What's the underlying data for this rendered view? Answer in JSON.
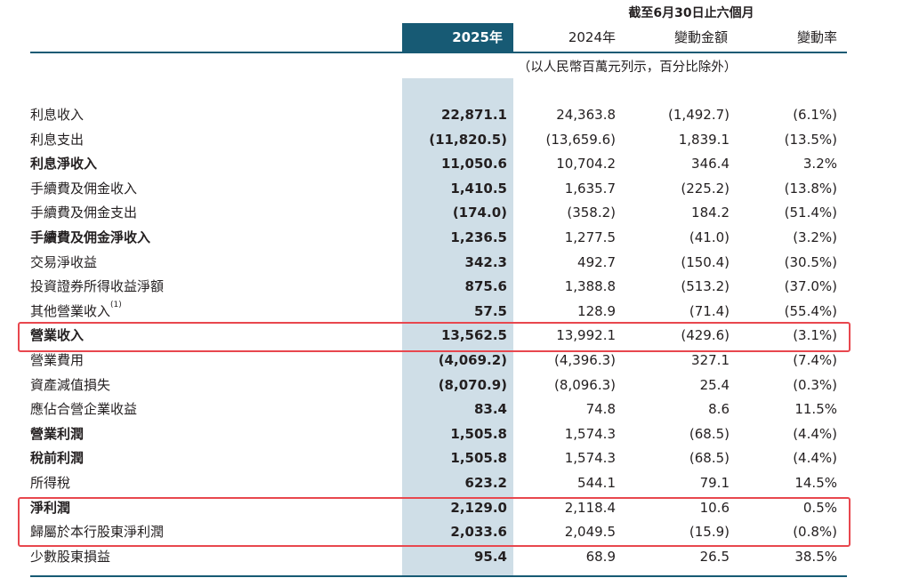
{
  "header": {
    "period": "截至6月30日止六個月",
    "col_2025": "2025年",
    "col_2024": "2024年",
    "col_change": "變動金額",
    "col_rate": "變動率",
    "unit_note": "（以人民幣百萬元列示，百分比除外）"
  },
  "rows": [
    {
      "label": "利息收入",
      "bold": false,
      "v2025": "22,871.1",
      "v2024": "24,363.8",
      "change": "(1,492.7)",
      "rate": "(6.1%)"
    },
    {
      "label": "利息支出",
      "bold": false,
      "v2025": "(11,820.5)",
      "v2024": "(13,659.6)",
      "change": "1,839.1",
      "rate": "(13.5%)"
    },
    {
      "label": "利息淨收入",
      "bold": true,
      "v2025": "11,050.6",
      "v2024": "10,704.2",
      "change": "346.4",
      "rate": "3.2%"
    },
    {
      "label": "手續費及佣金收入",
      "bold": false,
      "v2025": "1,410.5",
      "v2024": "1,635.7",
      "change": "(225.2)",
      "rate": "(13.8%)"
    },
    {
      "label": "手續費及佣金支出",
      "bold": false,
      "v2025": "(174.0)",
      "v2024": "(358.2)",
      "change": "184.2",
      "rate": "(51.4%)"
    },
    {
      "label": "手續費及佣金淨收入",
      "bold": true,
      "v2025": "1,236.5",
      "v2024": "1,277.5",
      "change": "(41.0)",
      "rate": "(3.2%)"
    },
    {
      "label": "交易淨收益",
      "bold": false,
      "v2025": "342.3",
      "v2024": "492.7",
      "change": "(150.4)",
      "rate": "(30.5%)"
    },
    {
      "label": "投資證券所得收益淨額",
      "bold": false,
      "v2025": "875.6",
      "v2024": "1,388.8",
      "change": "(513.2)",
      "rate": "(37.0%)"
    },
    {
      "label": "其他營業收入",
      "sup": "(1)",
      "bold": false,
      "v2025": "57.5",
      "v2024": "128.9",
      "change": "(71.4)",
      "rate": "(55.4%)"
    },
    {
      "label": "營業收入",
      "bold": true,
      "v2025": "13,562.5",
      "v2024": "13,992.1",
      "change": "(429.6)",
      "rate": "(3.1%)"
    },
    {
      "label": "營業費用",
      "bold": false,
      "v2025": "(4,069.2)",
      "v2024": "(4,396.3)",
      "change": "327.1",
      "rate": "(7.4%)"
    },
    {
      "label": "資產減值損失",
      "bold": false,
      "v2025": "(8,070.9)",
      "v2024": "(8,096.3)",
      "change": "25.4",
      "rate": "(0.3%)"
    },
    {
      "label": "應佔合營企業收益",
      "bold": false,
      "v2025": "83.4",
      "v2024": "74.8",
      "change": "8.6",
      "rate": "11.5%"
    },
    {
      "label": "營業利潤",
      "bold": true,
      "v2025": "1,505.8",
      "v2024": "1,574.3",
      "change": "(68.5)",
      "rate": "(4.4%)"
    },
    {
      "label": "稅前利潤",
      "bold": true,
      "v2025": "1,505.8",
      "v2024": "1,574.3",
      "change": "(68.5)",
      "rate": "(4.4%)"
    },
    {
      "label": "所得稅",
      "bold": false,
      "v2025": "623.2",
      "v2024": "544.1",
      "change": "79.1",
      "rate": "14.5%"
    },
    {
      "label": "淨利潤",
      "bold": true,
      "v2025": "2,129.0",
      "v2024": "2,118.4",
      "change": "10.6",
      "rate": "0.5%"
    },
    {
      "label": "歸屬於本行股東淨利潤",
      "bold": false,
      "v2025": "2,033.6",
      "v2024": "2,049.5",
      "change": "(15.9)",
      "rate": "(0.8%)"
    },
    {
      "label": "少數股東損益",
      "bold": false,
      "v2025": "95.4",
      "v2024": "68.9",
      "change": "26.5",
      "rate": "38.5%"
    }
  ],
  "colors": {
    "header_bg": "#175a74",
    "highlight_col": "#cfdee7",
    "annotation_box": "#e8474e"
  }
}
